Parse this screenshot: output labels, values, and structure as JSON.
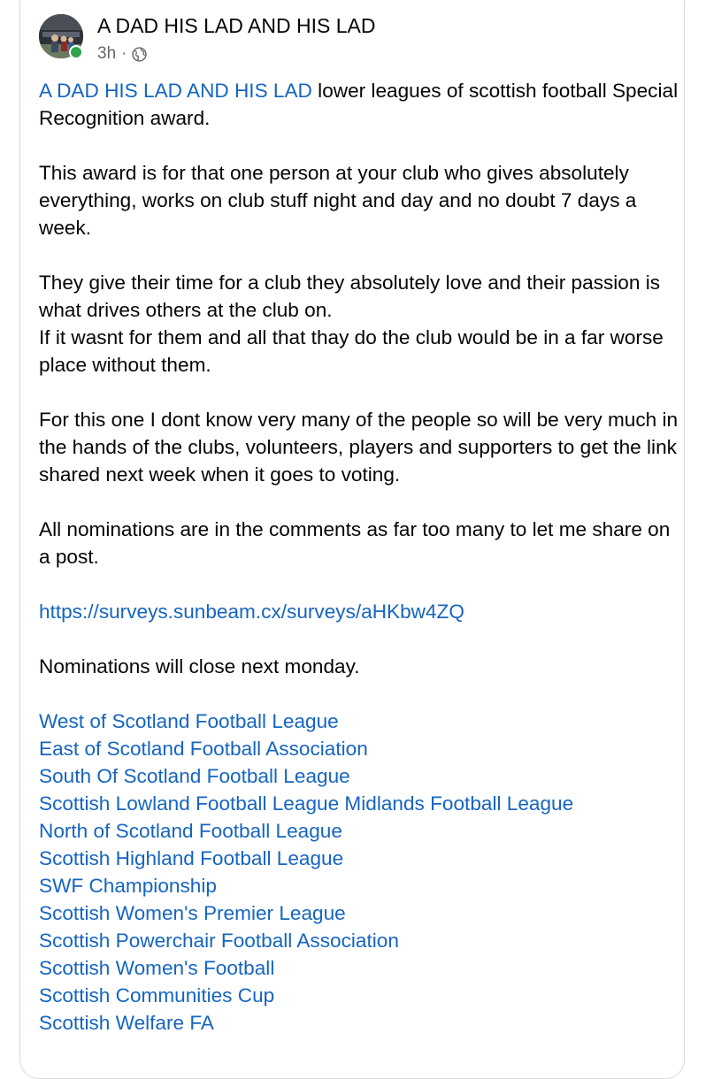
{
  "header": {
    "page_name": "A DAD HIS LAD AND HIS LAD",
    "timestamp": "3h",
    "separator": "·",
    "audience_icon": "globe-icon",
    "online": true
  },
  "post": {
    "intro_link": "A DAD HIS LAD AND HIS LAD",
    "intro_text": " lower leagues of scottish football Special Recognition award.",
    "paragraph_1": "This award is for that one person at your club who gives absolutely everything, works on club stuff night and day and no doubt 7 days a week.",
    "paragraph_2_line_1": "They give their time for a club they absolutely love and their passion is what drives others at the club on.",
    "paragraph_2_line_2": "If it wasnt for them and all that thay do the club would be in a far worse place without them.",
    "paragraph_3": "For this one I dont know very many of the people so will be very much in the hands of the clubs, volunteers, players and supporters to get the link shared next week when it goes to voting.",
    "paragraph_4": "All nominations are in the comments as far too many to let me share on a post.",
    "survey_link": "https://surveys.sunbeam.cx/surveys/aHKbw4ZQ",
    "closing_note": "Nominations will close next monday.",
    "leagues": [
      "West of Scotland Football League",
      "East of Scotland Football Association",
      "South Of Scotland Football League",
      "Scottish Lowland Football League Midlands Football League",
      "North of Scotland Football League",
      "Scottish Highland Football League",
      "SWF Championship",
      "Scottish Women's Premier League",
      "Scottish Powerchair Football Association",
      "Scottish Women's Football",
      "Scottish Communities Cup",
      "Scottish Welfare FA"
    ]
  },
  "colors": {
    "link": "#1565c0",
    "text": "#050505",
    "meta": "#65676b",
    "online": "#31a24c",
    "border": "#d8dadf"
  }
}
